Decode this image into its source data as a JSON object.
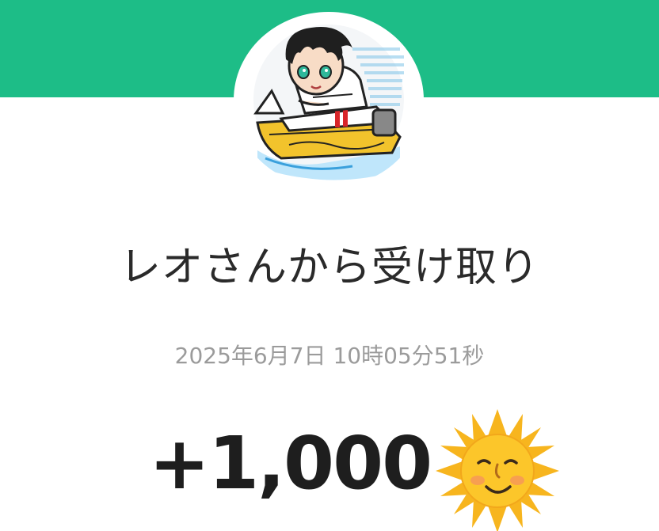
{
  "header": {
    "band_color": "#1dbd87",
    "avatar_icon": "boat-racer-avatar-icon"
  },
  "transfer": {
    "title": "レオさんから受け取り",
    "timestamp": "2025年6月7日 10時05分51秒",
    "amount": "+1,000",
    "emoji_icon": "sun-with-face-icon"
  }
}
